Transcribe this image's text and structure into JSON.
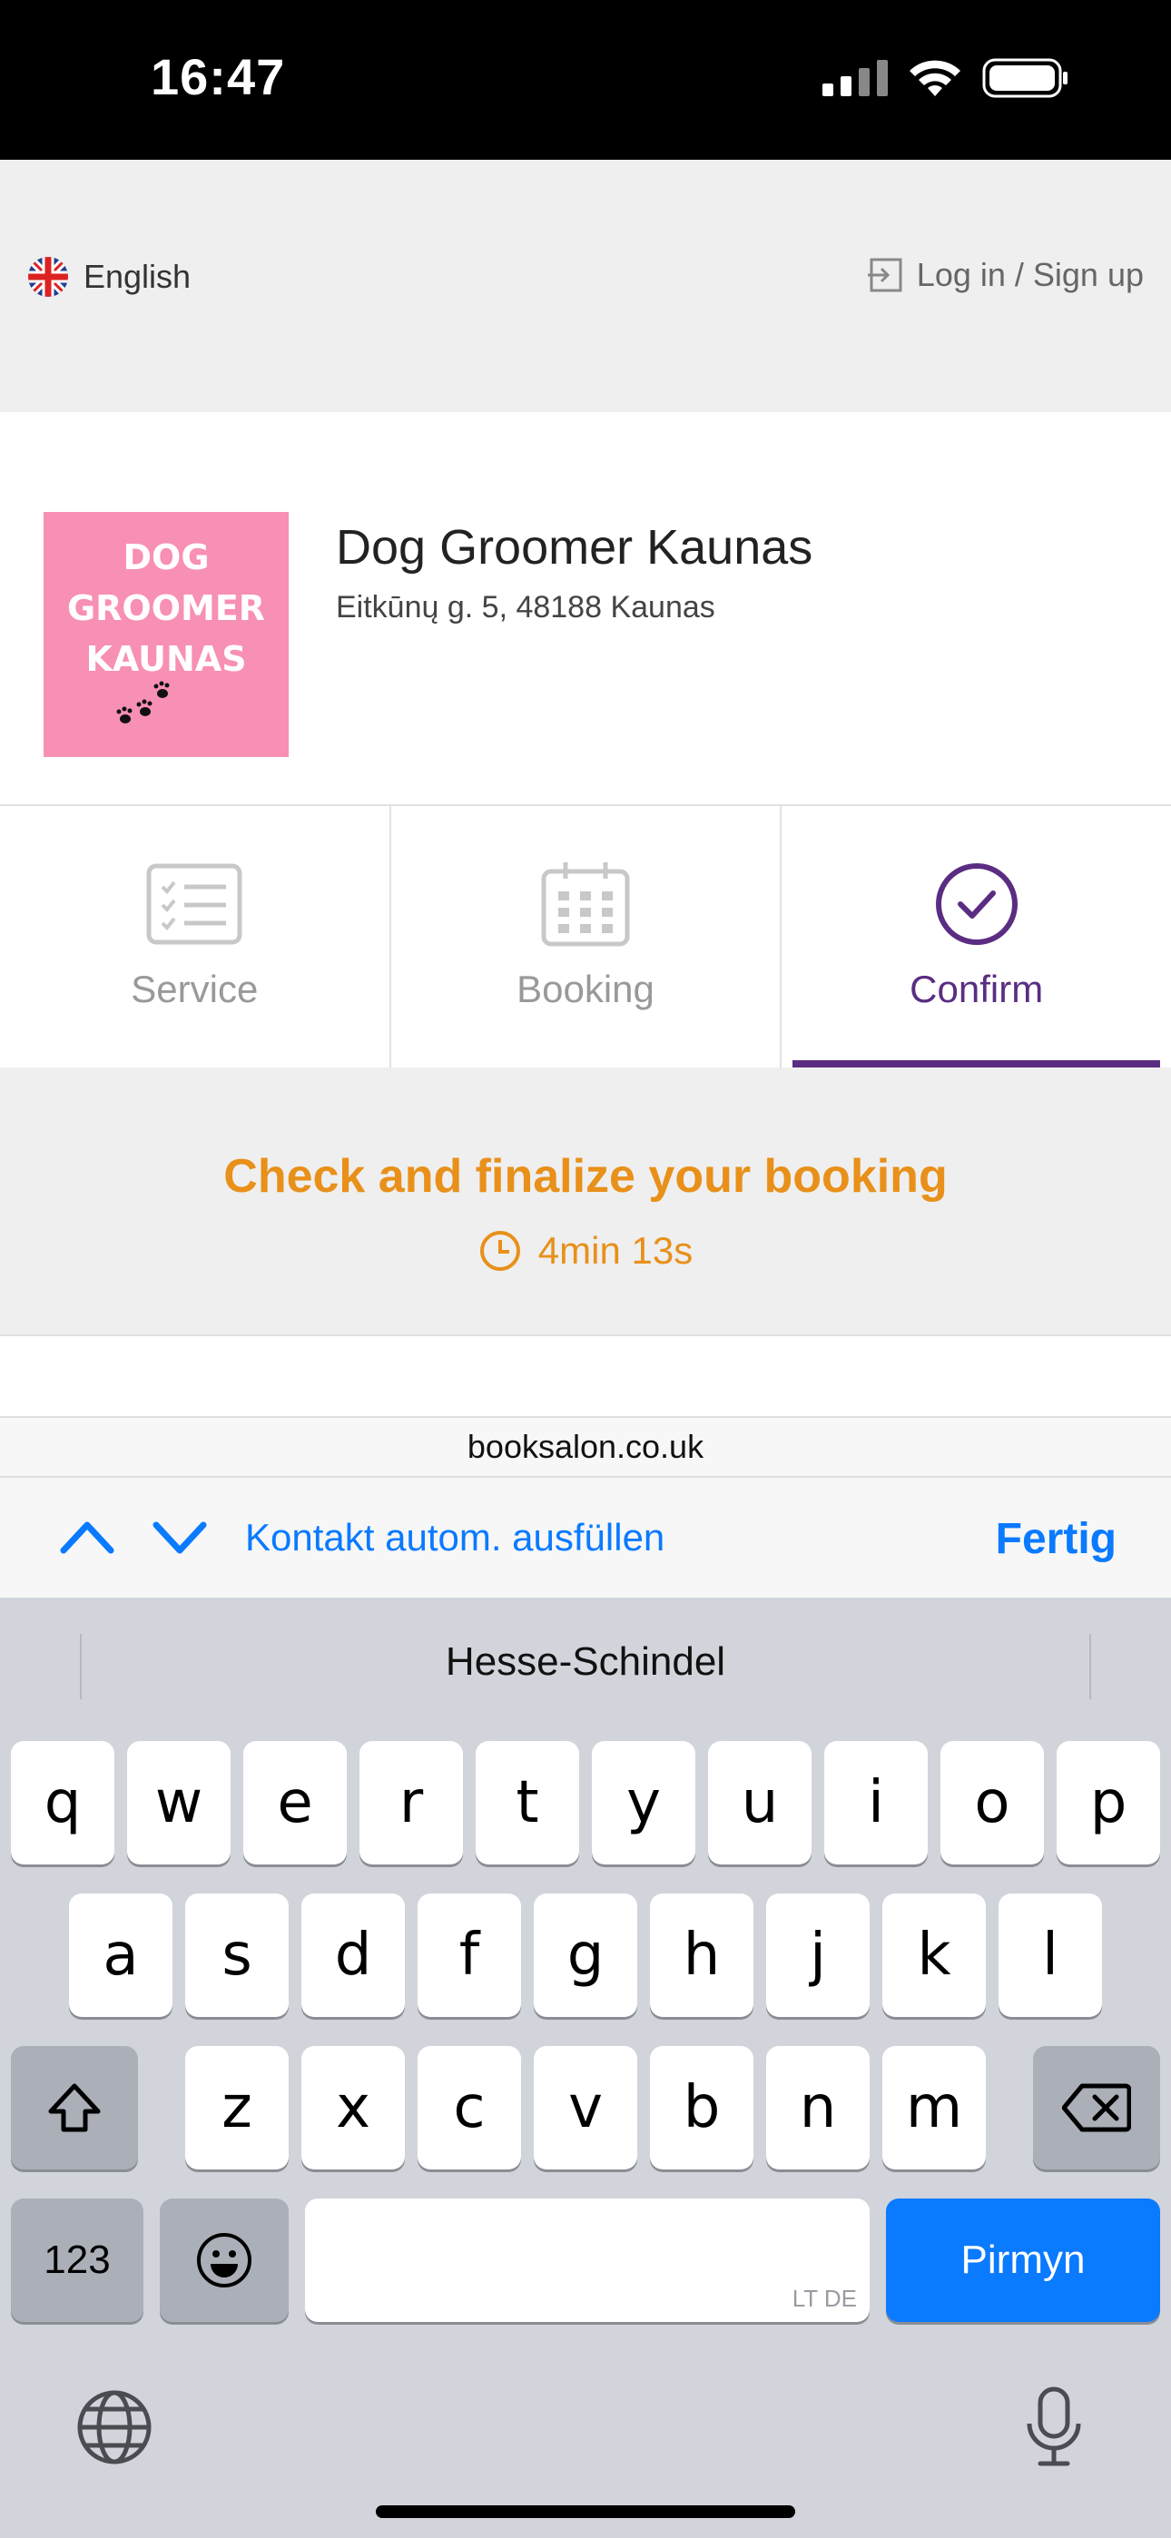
{
  "status_bar": {
    "time": "16:47"
  },
  "top_bar": {
    "language": "English",
    "login": "Log in / Sign up"
  },
  "salon": {
    "logo_lines": [
      "DOG",
      "GROOMER",
      "KAUNAS"
    ],
    "name": "Dog Groomer Kaunas",
    "address": "Eitkūnų g. 5, 48188 Kaunas"
  },
  "steps": [
    {
      "label": "Service",
      "icon": "list-icon",
      "active": false
    },
    {
      "label": "Booking",
      "icon": "calendar-icon",
      "active": false
    },
    {
      "label": "Confirm",
      "icon": "check-circle-icon",
      "active": true
    }
  ],
  "finalize": {
    "title": "Check and finalize your booking",
    "timer": "4min 13s"
  },
  "browser": {
    "url": "booksalon.co.uk"
  },
  "autofill": {
    "label": "Kontakt autom. ausfüllen",
    "done": "Fertig"
  },
  "keyboard": {
    "suggestion": "Hesse-Schindel",
    "row1": [
      "q",
      "w",
      "e",
      "r",
      "t",
      "y",
      "u",
      "i",
      "o",
      "p"
    ],
    "row2": [
      "a",
      "s",
      "d",
      "f",
      "g",
      "h",
      "j",
      "k",
      "l"
    ],
    "row3": [
      "z",
      "x",
      "c",
      "v",
      "b",
      "n",
      "m"
    ],
    "numbers_key": "123",
    "space_hint": "LT DE",
    "go_key": "Pirmyn"
  },
  "colors": {
    "accent_purple": "#5a2d82",
    "accent_orange": "#e8901a",
    "ios_blue": "#0a7aff",
    "logo_pink": "#f88fb5"
  }
}
